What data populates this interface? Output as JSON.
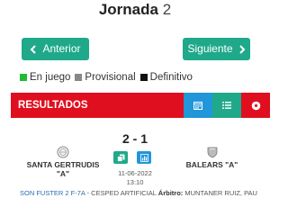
{
  "header": {
    "title_word": "Jornada",
    "title_number": "2"
  },
  "nav": {
    "prev_label": "Anterior",
    "next_label": "Siguiente"
  },
  "legend": [
    {
      "label": "En juego",
      "color": "#22bb33"
    },
    {
      "label": "Provisional",
      "color": "#888888"
    },
    {
      "label": "Definitivo",
      "color": "#111111"
    }
  ],
  "results": {
    "label": "RESULTADOS",
    "icons": [
      "calendar-icon",
      "list-icon",
      "ball-icon"
    ]
  },
  "match": {
    "score": "2 - 1",
    "home": "SANTA GERTRUDIS \"A\"",
    "away": "BALEARS \"A\"",
    "date": "11-06-2022",
    "time": "13:10",
    "field": "SON FUSTER 2 F-7A",
    "surface": " - CESPED ARTIFICIAL ",
    "referee_label": "Árbitro:",
    "referee": " MUNTANER RUIZ, PAU"
  },
  "colors": {
    "accent": "#1fa98a",
    "red": "#e00f1f",
    "blue": "#2196d9"
  }
}
